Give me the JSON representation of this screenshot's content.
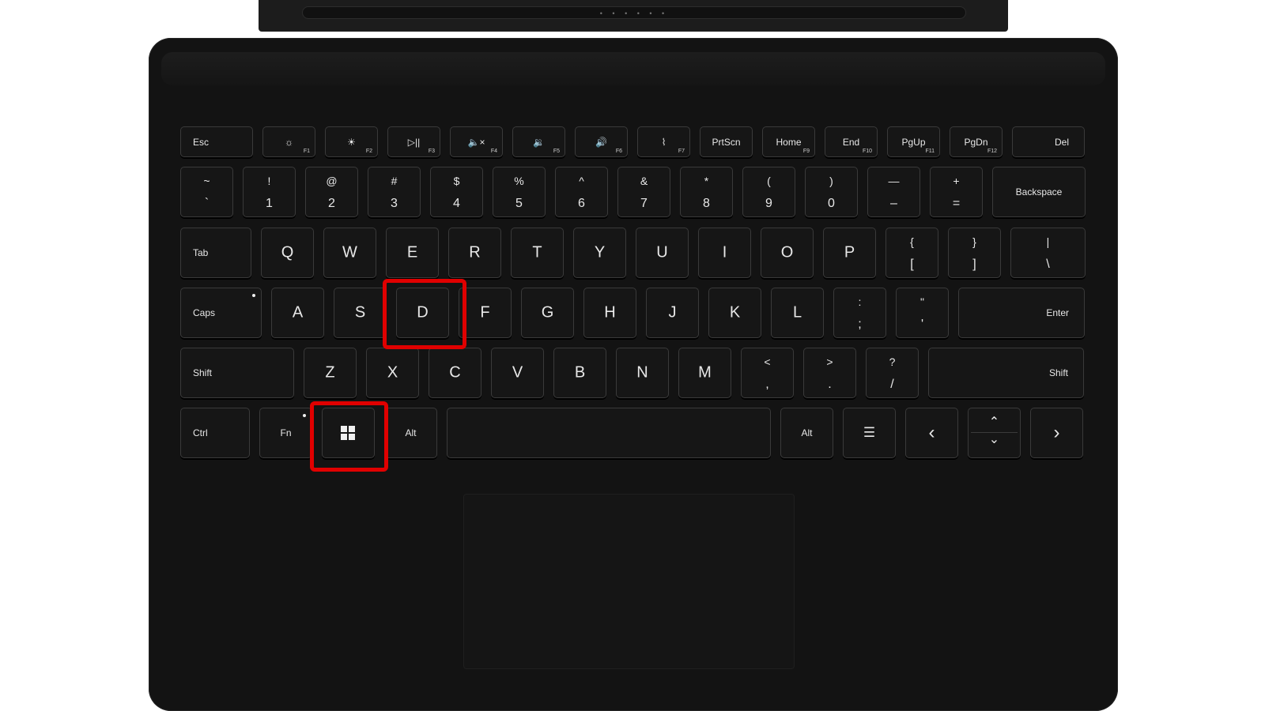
{
  "keyboard": {
    "function_row": [
      {
        "name": "key-esc",
        "label": "Esc",
        "fn": "",
        "icon": ""
      },
      {
        "name": "key-f1",
        "label": "",
        "fn": "F1",
        "icon": "☼"
      },
      {
        "name": "key-f2",
        "label": "",
        "fn": "F2",
        "icon": "☀"
      },
      {
        "name": "key-f3",
        "label": "",
        "fn": "F3",
        "icon": "▷||"
      },
      {
        "name": "key-f4",
        "label": "",
        "fn": "F4",
        "icon": "🔈×"
      },
      {
        "name": "key-f5",
        "label": "",
        "fn": "F5",
        "icon": "🔉"
      },
      {
        "name": "key-f6",
        "label": "",
        "fn": "F6",
        "icon": "🔊"
      },
      {
        "name": "key-f7",
        "label": "",
        "fn": "F7",
        "icon": "⌇"
      },
      {
        "name": "key-prtscn",
        "label": "PrtScn",
        "fn": "",
        "icon": ""
      },
      {
        "name": "key-home",
        "label": "Home",
        "fn": "F9",
        "icon": ""
      },
      {
        "name": "key-end",
        "label": "End",
        "fn": "F10",
        "icon": ""
      },
      {
        "name": "key-pgup",
        "label": "PgUp",
        "fn": "F11",
        "icon": ""
      },
      {
        "name": "key-pgdn",
        "label": "PgDn",
        "fn": "F12",
        "icon": ""
      },
      {
        "name": "key-del",
        "label": "Del",
        "fn": "",
        "icon": ""
      }
    ],
    "number_row": [
      {
        "top": "~",
        "bot": "`"
      },
      {
        "top": "!",
        "bot": "1"
      },
      {
        "top": "@",
        "bot": "2"
      },
      {
        "top": "#",
        "bot": "3"
      },
      {
        "top": "$",
        "bot": "4"
      },
      {
        "top": "%",
        "bot": "5"
      },
      {
        "top": "^",
        "bot": "6"
      },
      {
        "top": "&",
        "bot": "7"
      },
      {
        "top": "*",
        "bot": "8"
      },
      {
        "top": "(",
        "bot": "9"
      },
      {
        "top": ")",
        "bot": "0"
      },
      {
        "top": "—",
        "bot": "–"
      },
      {
        "top": "+",
        "bot": "="
      }
    ],
    "backspace": "Backspace",
    "tab": "Tab",
    "qwerty_row": [
      "Q",
      "W",
      "E",
      "R",
      "T",
      "Y",
      "U",
      "I",
      "O",
      "P"
    ],
    "qwerty_symbols": [
      {
        "top": "{",
        "bot": "["
      },
      {
        "top": "}",
        "bot": "]"
      },
      {
        "top": "|",
        "bot": "\\"
      }
    ],
    "caps": "Caps",
    "home_row": [
      "A",
      "S",
      "D",
      "F",
      "G",
      "H",
      "J",
      "K",
      "L"
    ],
    "home_symbols": [
      {
        "top": ":",
        "bot": ";"
      },
      {
        "top": "\"",
        "bot": "'"
      }
    ],
    "enter": "Enter",
    "shift_left": "Shift",
    "bottom_row": [
      "Z",
      "X",
      "C",
      "V",
      "B",
      "N",
      "M"
    ],
    "bottom_symbols": [
      {
        "top": "<",
        "bot": ","
      },
      {
        "top": ">",
        "bot": "."
      },
      {
        "top": "?",
        "bot": "/"
      }
    ],
    "shift_right": "Shift",
    "ctrl": "Ctrl",
    "fn_key": "Fn",
    "alt_left": "Alt",
    "alt_right": "Alt"
  },
  "highlighted_keys": [
    "D",
    "Windows"
  ],
  "colors": {
    "highlight": "#e00000",
    "keyboard_body": "#131313",
    "key_fill": "#161616"
  },
  "icons": {
    "windows": "windows-logo-icon",
    "menu": "menu-key-icon"
  }
}
